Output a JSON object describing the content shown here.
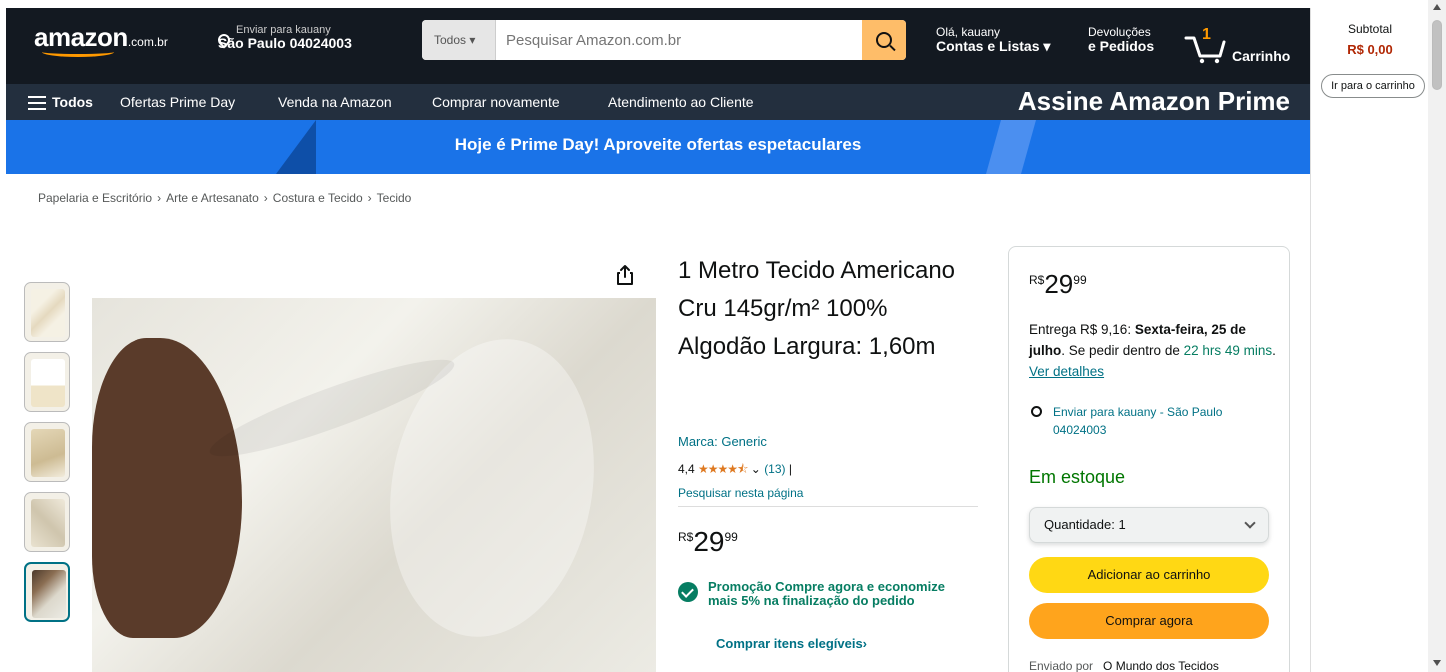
{
  "header": {
    "logo_text": "amazon",
    "logo_suffix": ".com.br",
    "deliver_line1": "Enviar para kauany",
    "deliver_line2": "São Paulo 04024003",
    "search_category": "Todos",
    "search_placeholder": "Pesquisar Amazon.com.br",
    "account_line1": "Olá, kauany",
    "account_line2": "Contas e Listas",
    "orders_line1": "Devoluções",
    "orders_line2": "e Pedidos",
    "cart_count": "1",
    "cart_label": "Carrinho"
  },
  "subnav": {
    "all_label": "Todos",
    "items": [
      "Ofertas Prime Day",
      "Venda na Amazon",
      "Comprar novamente",
      "Atendimento ao Cliente"
    ],
    "prime_cta": "Assine Amazon Prime"
  },
  "banner": {
    "text": "Hoje é Prime Day! Aproveite ofertas espetaculares"
  },
  "side_cart": {
    "subtotal_label": "Subtotal",
    "subtotal_value": "R$ 0,00",
    "go_to_cart": "Ir para o carrinho"
  },
  "breadcrumb": [
    "Papelaria e Escritório",
    "Arte e Artesanato",
    "Costura e Tecido",
    "Tecido"
  ],
  "product": {
    "title": "1 Metro Tecido Americano Cru 145gr/m² 100% Algodão Largura: 1,60m",
    "brand": "Marca: Generic",
    "rating_value": "4,4",
    "rating_stars": "★★★★⯪",
    "rating_count": "(13)",
    "search_page": "Pesquisar nesta página",
    "price_currency": "R$",
    "price_int": "29",
    "price_dec": "99",
    "promo_text": "Promoção Compre agora e economize mais 5% na finalização do pedido",
    "promo_link": "Comprar itens elegíveis"
  },
  "buybox": {
    "price_currency": "R$",
    "price_int": "29",
    "price_dec": "99",
    "delivery_prefix": "Entrega R$ 9,16: ",
    "delivery_date": "Sexta-feira, 25 de julho",
    "delivery_mid": ". Se pedir dentro de ",
    "delivery_time": "22 hrs 49 mins",
    "delivery_link": "Ver detalhes",
    "location": "Enviar para kauany - São Paulo 04024003",
    "stock": "Em estoque",
    "quantity": "Quantidade: 1",
    "add_to_cart": "Adicionar ao carrinho",
    "buy_now": "Comprar agora",
    "sold_by_label": "Enviado por",
    "sold_by_value": "O Mundo dos Tecidos"
  },
  "colors": {
    "nav_dark": "#131921",
    "subnav": "#232f3e",
    "banner_blue": "#1a73e8",
    "accent_orange": "#ff9900",
    "add_to_cart": "#ffd814",
    "buy_now": "#ffa41c",
    "stock_green": "#007600"
  }
}
